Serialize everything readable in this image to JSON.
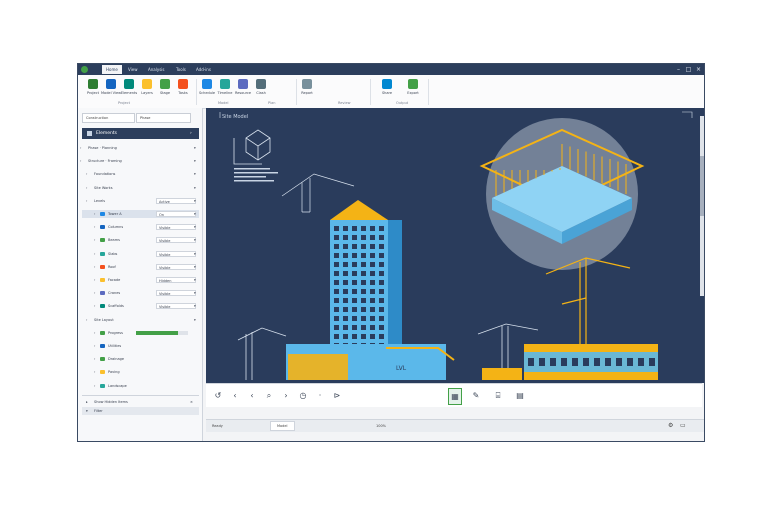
{
  "titlebar": {
    "tabs": [
      "Home",
      "View",
      "Analysis",
      "Tools",
      "Add-ins"
    ],
    "active_tab": 0,
    "accent": "#2c3e5c"
  },
  "ribbon": {
    "buttons": [
      {
        "label": "Project",
        "icon": "project-icon",
        "color": "#2e7d32"
      },
      {
        "label": "Model View",
        "icon": "model-icon",
        "color": "#1565c0"
      },
      {
        "label": "Elements",
        "icon": "elements-icon",
        "color": "#00897b"
      },
      {
        "label": "Layers",
        "icon": "layers-icon",
        "color": "#fbc02d"
      },
      {
        "label": "Stage",
        "icon": "stage-icon",
        "color": "#43a047"
      },
      {
        "label": "Tasks",
        "icon": "tasks-icon",
        "color": "#f4511e"
      },
      {
        "label": "Schedule",
        "icon": "schedule-icon",
        "color": "#1e88e5"
      },
      {
        "label": "Timeline",
        "icon": "timeline-icon",
        "color": "#26a69a"
      },
      {
        "label": "Resource",
        "icon": "resource-icon",
        "color": "#5c6bc0"
      },
      {
        "label": "Clash",
        "icon": "clash-icon",
        "color": "#546e7a"
      },
      {
        "label": "Report",
        "icon": "report-icon",
        "color": "#78909c"
      },
      {
        "label": "Share",
        "icon": "share-icon",
        "color": "#0288d1"
      },
      {
        "label": "Export",
        "icon": "export-icon",
        "color": "#43a047"
      }
    ],
    "groups": [
      "Project",
      "Model",
      "Plan",
      "Review",
      "Output"
    ]
  },
  "left_panel": {
    "combo_left": "Construction",
    "combo_right": "Phase",
    "header": "Elements",
    "rows": [
      {
        "text": "Phase · Planning",
        "value": "",
        "color": ""
      },
      {
        "text": "Structure · Framing",
        "value": "",
        "color": ""
      },
      {
        "text": "Foundations",
        "value": "",
        "color": ""
      },
      {
        "text": "Site Works",
        "value": "",
        "color": ""
      },
      {
        "text": "Levels",
        "value": "Active",
        "color": ""
      },
      {
        "text": "Tower A",
        "value": "On",
        "color": "#1e88e5"
      },
      {
        "text": "Columns",
        "value": "Visible",
        "color": "#1565c0"
      },
      {
        "text": "Beams",
        "value": "Visible",
        "color": "#43a047"
      },
      {
        "text": "Slabs",
        "value": "Visible",
        "color": "#26a69a"
      },
      {
        "text": "Roof",
        "value": "Visible",
        "color": "#f4511e"
      },
      {
        "text": "Facade",
        "value": "Hidden",
        "color": "#fbc02d"
      },
      {
        "text": "Cranes",
        "value": "Visible",
        "color": "#5c6bc0"
      },
      {
        "text": "Scaffolds",
        "value": "Visible",
        "color": "#00897b"
      },
      {
        "text": "Site Layout",
        "value": "",
        "color": ""
      },
      {
        "text": "Progress",
        "value": "",
        "color": "#43a047",
        "progress": 0.8
      },
      {
        "text": "Utilities",
        "value": "",
        "color": "#1565c0"
      },
      {
        "text": "Drainage",
        "value": "",
        "color": "#43a047"
      },
      {
        "text": "Paving",
        "value": "",
        "color": "#fbc02d"
      },
      {
        "text": "Landscape",
        "value": "",
        "color": "#26a69a"
      }
    ],
    "footer_note": "Show Hidden Items",
    "footer_item": "Filter"
  },
  "canvas": {
    "label": "Site Model",
    "bg": "#2a3c5c",
    "accent_yellow": "#f4b315",
    "accent_blue": "#5bb8ea"
  },
  "canvas_toolbar": {
    "tools": [
      "↺",
      "‹",
      "‹",
      "⌕",
      "›",
      "◷",
      "·",
      "⊳",
      "▦",
      "✎",
      "⌸",
      "▤"
    ],
    "tool_names": [
      "Rotate",
      "Back",
      "Prev",
      "Zoom",
      "Next",
      "Time",
      "Point",
      "Play",
      "Stage",
      "Edit",
      "Measure",
      "Report"
    ]
  },
  "status": {
    "left": "Ready",
    "zoom": "100%",
    "mode": "Model"
  }
}
